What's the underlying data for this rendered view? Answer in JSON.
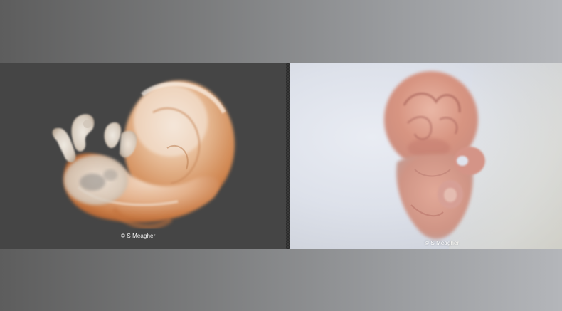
{
  "slide": {
    "background_colors": [
      "#5d5d5d",
      "#b4b6ba"
    ]
  },
  "left_photo": {
    "subject": "embryo-side-view",
    "background_color": "#454545",
    "credit": "© S Meagher"
  },
  "right_photo": {
    "subject": "embryo-frontal-view",
    "background_color": "#dde1ea",
    "credit": "© S Meagher"
  }
}
